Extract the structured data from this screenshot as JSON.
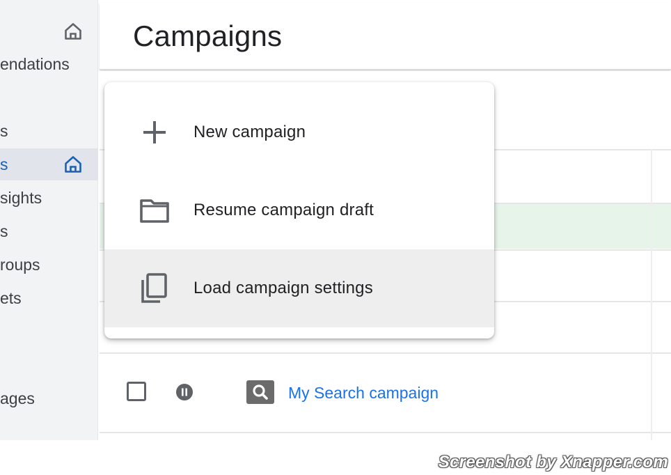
{
  "sidebar": {
    "items": [
      {
        "label": "",
        "icon": "home-icon",
        "active": false
      },
      {
        "label": "endations",
        "icon": "",
        "active": false
      },
      {
        "label": "s",
        "icon": "",
        "active": false
      },
      {
        "label": "s",
        "icon": "home-icon",
        "active": true
      },
      {
        "label": "sights",
        "icon": "",
        "active": false
      },
      {
        "label": "s",
        "icon": "",
        "active": false
      },
      {
        "label": "roups",
        "icon": "",
        "active": false
      },
      {
        "label": "ets",
        "icon": "",
        "active": false
      },
      {
        "label": "ages",
        "icon": "",
        "active": false
      }
    ]
  },
  "header": {
    "title": "Campaigns"
  },
  "menu": {
    "items": [
      {
        "label": "New campaign",
        "icon": "plus-icon"
      },
      {
        "label": "Resume campaign draft",
        "icon": "folder-icon"
      },
      {
        "label": "Load campaign settings",
        "icon": "copy-icon"
      }
    ],
    "hovered_index": 2
  },
  "table": {
    "rows": [
      {
        "status_icon": "paused-icon",
        "type_icon": "search-icon",
        "name": "My Search campaign"
      }
    ]
  },
  "watermark": "Screenshot by Xnapper.com",
  "colors": {
    "sidebar_bg": "#f1f3f4",
    "active_accent": "#1a5fb4",
    "link": "#1a73e8",
    "highlight_row": "#e7f4ea",
    "menu_hover": "#eeeeee"
  }
}
